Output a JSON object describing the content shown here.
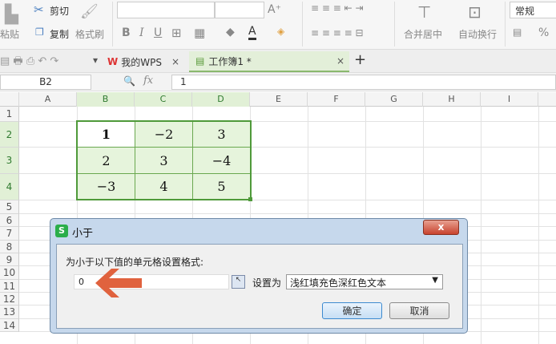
{
  "ribbon": {
    "cut": "剪切",
    "paste": "粘贴",
    "copy": "复制",
    "format_painter": "格式刷",
    "bold": "B",
    "italic": "I",
    "underline": "U",
    "font_color": "A",
    "merge_center": "合并居中",
    "wrap_text": "自动换行",
    "number_format": "常规",
    "percent": "%"
  },
  "tabs": [
    {
      "label": "我的WPS"
    },
    {
      "label": "工作簿1 *"
    }
  ],
  "formula_bar": {
    "name_box": "B2",
    "fx": "fx",
    "value": "1"
  },
  "columns": [
    "A",
    "B",
    "C",
    "D",
    "E",
    "F",
    "G",
    "H",
    "I"
  ],
  "rows": [
    "1",
    "2",
    "3",
    "4",
    "5",
    "6",
    "7",
    "8",
    "9",
    "10",
    "11",
    "12",
    "13",
    "14"
  ],
  "cells": [
    [
      "1",
      "−2",
      "3"
    ],
    [
      "2",
      "3",
      "−4"
    ],
    [
      "−3",
      "4",
      "5"
    ]
  ],
  "dialog": {
    "title": "小于",
    "prompt": "为小于以下值的单元格设置格式:",
    "value": "0",
    "set_as": "设置为",
    "format": "浅红填充色深红色文本",
    "ok": "确定",
    "cancel": "取消",
    "close": "x"
  }
}
